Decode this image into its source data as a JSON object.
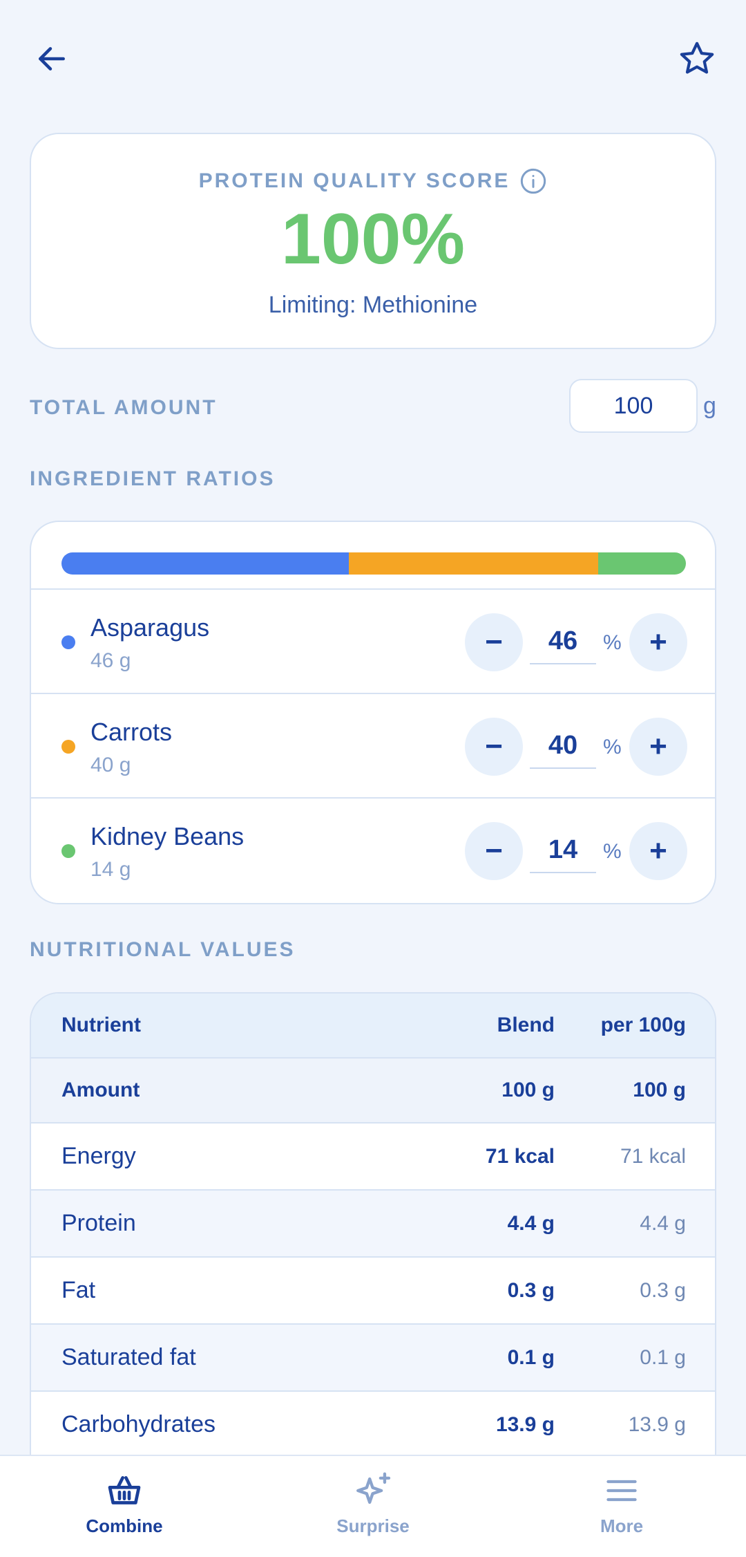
{
  "header": {
    "back_icon": "arrow-left-icon",
    "favorite_icon": "star-icon"
  },
  "score": {
    "label": "PROTEIN QUALITY SCORE",
    "value": "100%",
    "limiting": "Limiting: Methionine",
    "info_icon": "info-icon",
    "value_color": "#6ac671"
  },
  "total": {
    "label": "TOTAL AMOUNT",
    "value": "100",
    "unit": "g"
  },
  "ratios": {
    "title": "INGREDIENT RATIOS",
    "ingredients": [
      {
        "name": "Asparagus",
        "grams": "46 g",
        "percent": "46",
        "percent_value": 46,
        "color": "#4a7ef0"
      },
      {
        "name": "Carrots",
        "grams": "40 g",
        "percent": "40",
        "percent_value": 40,
        "color": "#f5a524"
      },
      {
        "name": "Kidney Beans",
        "grams": "14 g",
        "percent": "14",
        "percent_value": 14,
        "color": "#6ac671"
      }
    ],
    "percent_sign": "%",
    "minus_label": "−",
    "plus_label": "+"
  },
  "nutrition": {
    "title": "NUTRITIONAL VALUES",
    "headers": {
      "nutrient": "Nutrient",
      "blend": "Blend",
      "per100": "per 100g"
    },
    "amount_row": {
      "name": "Amount",
      "blend": "100 g",
      "per100": "100 g"
    },
    "rows": [
      {
        "name": "Energy",
        "blend": "71 kcal",
        "per100": "71 kcal"
      },
      {
        "name": "Protein",
        "blend": "4.4 g",
        "per100": "4.4 g"
      },
      {
        "name": "Fat",
        "blend": "0.3 g",
        "per100": "0.3 g"
      },
      {
        "name": "Saturated fat",
        "blend": "0.1 g",
        "per100": "0.1 g"
      },
      {
        "name": "Carbohydrates",
        "blend": "13.9 g",
        "per100": "13.9 g"
      }
    ]
  },
  "nav": {
    "items": [
      {
        "label": "Combine",
        "icon": "basket-icon",
        "active": true
      },
      {
        "label": "Surprise",
        "icon": "sparkle-icon",
        "active": false
      },
      {
        "label": "More",
        "icon": "menu-icon",
        "active": false
      }
    ],
    "active_color": "#1a3f99",
    "inactive_color": "#8aa3cc"
  }
}
